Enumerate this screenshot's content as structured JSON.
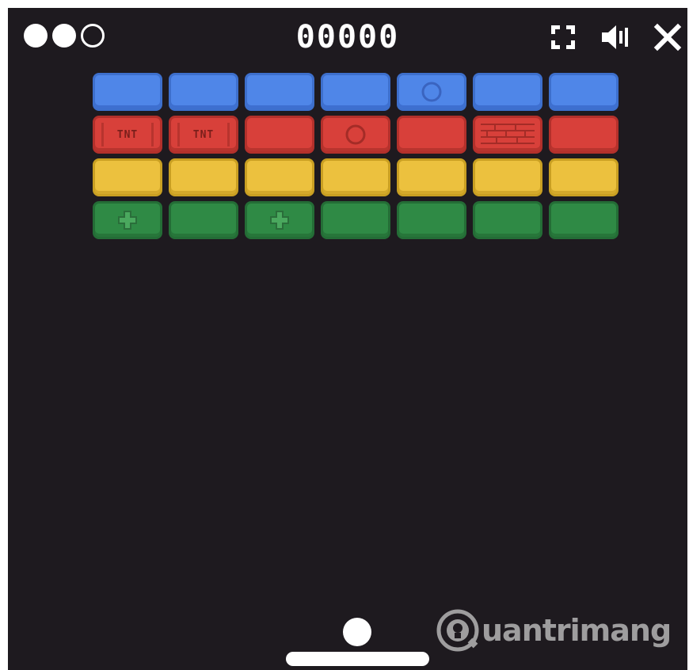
{
  "hud": {
    "lives": [
      {
        "state": "full"
      },
      {
        "state": "full"
      },
      {
        "state": "empty"
      }
    ],
    "score": "00000",
    "controls": [
      {
        "icon": "fullscreen-icon"
      },
      {
        "icon": "sound-icon"
      },
      {
        "icon": "close-icon"
      }
    ]
  },
  "bricks": [
    [
      "blue",
      "blue",
      "blue",
      "blue",
      "blue-ring",
      "blue",
      "blue"
    ],
    [
      "red-tnt",
      "red-tnt",
      "red",
      "red-ring",
      "red",
      "red-brickwall",
      "red"
    ],
    [
      "yellow",
      "yellow",
      "yellow",
      "yellow",
      "yellow",
      "yellow",
      "yellow"
    ],
    [
      "green-plus",
      "green",
      "green-plus",
      "green",
      "green",
      "green",
      "green"
    ]
  ],
  "tnt_label": "TNT",
  "watermark": {
    "text": "uantrimang",
    "icon": "lightbulb-icon"
  },
  "colors": {
    "background": "#1e1a1f",
    "blue": "#4f86e8",
    "red": "#d8403a",
    "yellow": "#ecc13e",
    "green": "#2f8a45"
  }
}
